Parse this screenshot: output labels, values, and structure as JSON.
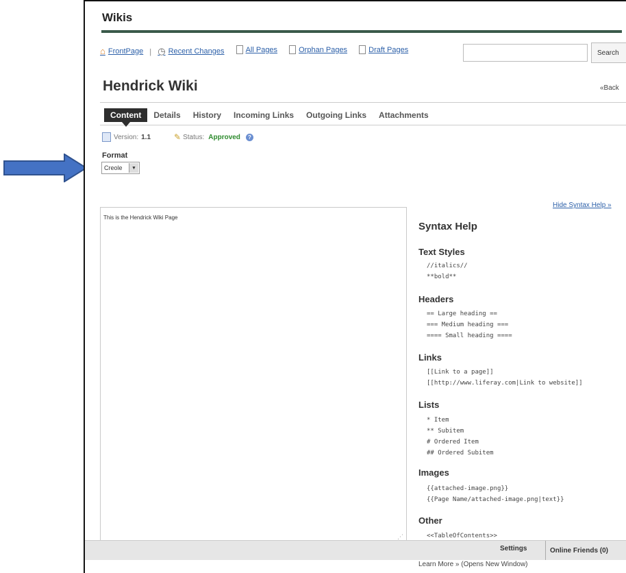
{
  "app": {
    "title": "Wikis"
  },
  "nav": {
    "front_page": "FrontPage",
    "recent_changes": "Recent Changes",
    "all_pages": "All Pages",
    "orphan_pages": "Orphan Pages",
    "draft_pages": "Draft Pages"
  },
  "search": {
    "button": "Search",
    "placeholder": ""
  },
  "page": {
    "title": "Hendrick Wiki",
    "back": "«Back"
  },
  "tabs": [
    "Content",
    "Details",
    "History",
    "Incoming Links",
    "Outgoing Links",
    "Attachments"
  ],
  "meta": {
    "version_label": "Version:",
    "version": "1.1",
    "status_label": "Status:",
    "status": "Approved"
  },
  "format": {
    "label": "Format",
    "value": "Creole"
  },
  "editor": {
    "content": "This is the Hendrick Wiki Page"
  },
  "syntax": {
    "hide_link": "Hide Syntax Help »",
    "title": "Syntax Help",
    "sections": [
      {
        "heading": "Text Styles",
        "lines": [
          "//italics//",
          "**bold**"
        ]
      },
      {
        "heading": "Headers",
        "lines": [
          "== Large heading ==",
          "=== Medium heading ===",
          "==== Small heading ===="
        ]
      },
      {
        "heading": "Links",
        "lines": [
          "[[Link to a page]]",
          "[[http://www.liferay.com|Link to website]]"
        ]
      },
      {
        "heading": "Lists",
        "lines": [
          "* Item",
          "** Subitem",
          "# Ordered Item",
          "## Ordered Subitem"
        ]
      },
      {
        "heading": "Images",
        "lines": [
          "{{attached-image.png}}",
          "{{Page Name/attached-image.png|text}}"
        ]
      },
      {
        "heading": "Other",
        "lines": [
          "<<TableOfContents>>"
        ]
      }
    ],
    "learn_more": "Learn More » (Opens New Window)"
  },
  "footer": {
    "settings": "Settings",
    "online_friends": "Online Friends (0)"
  },
  "colors": {
    "title_rule": "#3a5a4a",
    "approved": "#2e8b2e",
    "link": "#2b5fa8",
    "arrow": "#4472c4"
  }
}
